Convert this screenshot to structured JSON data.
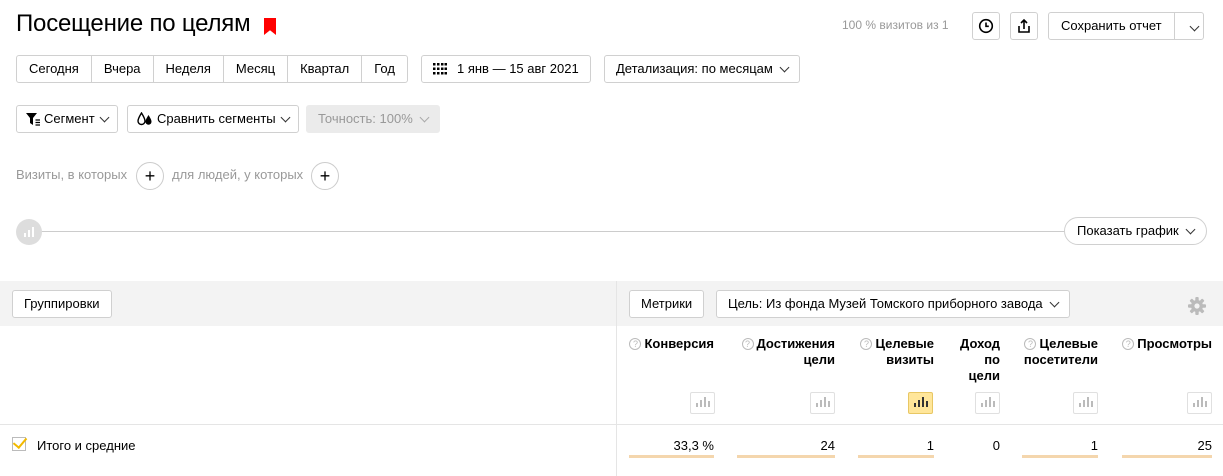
{
  "header": {
    "title": "Посещение по целям",
    "visits_note": "100 % визитов из 1",
    "save_report_label": "Сохранить отчет"
  },
  "period": {
    "options": [
      "Сегодня",
      "Вчера",
      "Неделя",
      "Месяц",
      "Квартал",
      "Год"
    ],
    "date_range": "1 янв — 15 авг 2021",
    "detail_label": "Детализация: по месяцам"
  },
  "segments": {
    "segment_label": "Сегмент",
    "compare_label": "Сравнить сегменты",
    "accuracy_label": "Точность: 100%"
  },
  "filters": {
    "visits_label": "Визиты, в которых",
    "people_label": "для людей, у которых"
  },
  "graph": {
    "show_label": "Показать график"
  },
  "table": {
    "groupings_label": "Группировки",
    "metrics_label": "Метрики",
    "goal_label": "Цель: Из фонда Музей Томского приборного завода",
    "columns": [
      {
        "label": "Конверсия",
        "help": true
      },
      {
        "label": "Достижения цели",
        "help": true
      },
      {
        "label": "Целевые визиты",
        "help": true
      },
      {
        "label": "Доход по цели",
        "help": false
      },
      {
        "label": "Целевые посетители",
        "help": true
      },
      {
        "label": "Просмотры",
        "help": true
      }
    ],
    "totals": {
      "label": "Итого и средние",
      "values": [
        "33,3 %",
        "24",
        "1",
        "0",
        "1",
        "25"
      ]
    }
  },
  "colors": {
    "accent_red": "#ff0000",
    "active_chart": "#ffe69a",
    "total_bar": "#f4d6ad",
    "checkbox": "#f2b900"
  }
}
